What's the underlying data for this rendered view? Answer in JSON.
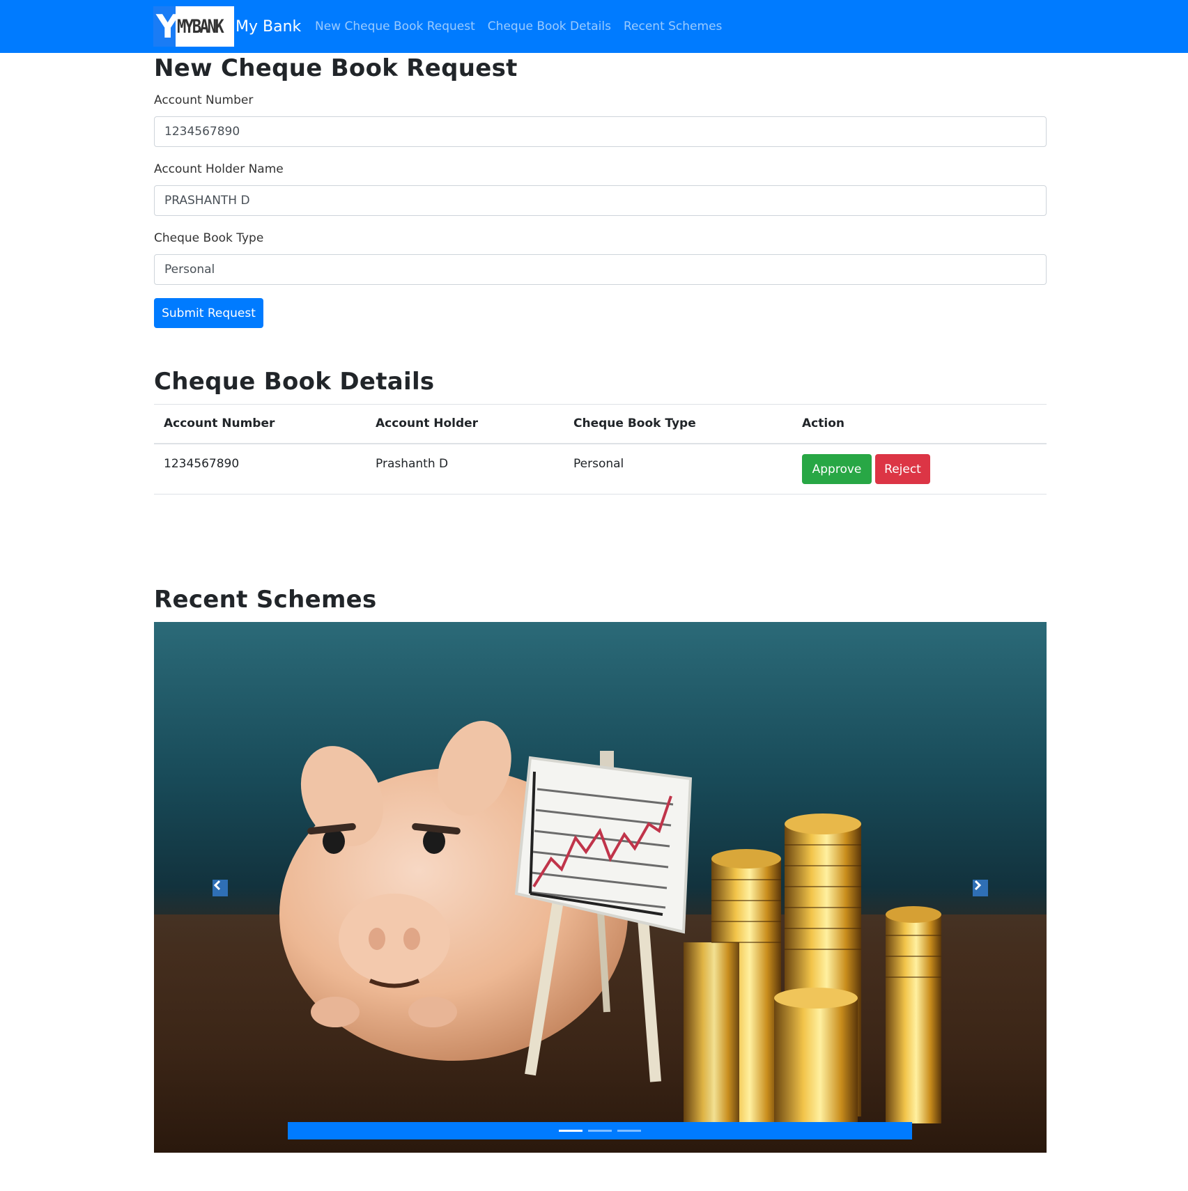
{
  "navbar": {
    "logo_text": "MYBANK",
    "logo_letter": "Y",
    "brand": "My Bank",
    "links": [
      {
        "label": "New Cheque Book Request"
      },
      {
        "label": "Cheque Book Details"
      },
      {
        "label": "Recent Schemes"
      }
    ]
  },
  "request_form": {
    "title": "New Cheque Book Request",
    "account_number_label": "Account Number",
    "account_number_value": "1234567890",
    "holder_name_label": "Account Holder Name",
    "holder_name_value": "PRASHANTH D",
    "book_type_label": "Cheque Book Type",
    "book_type_value": "Personal",
    "submit_label": "Submit Request"
  },
  "details": {
    "title": "Cheque Book Details",
    "columns": [
      "Account Number",
      "Account Holder",
      "Cheque Book Type",
      "Action"
    ],
    "rows": [
      {
        "account_number": "1234567890",
        "account_holder": "Prashanth D",
        "book_type": "Personal",
        "approve_label": "Approve",
        "reject_label": "Reject"
      }
    ]
  },
  "schemes": {
    "title": "Recent Schemes",
    "slide_count": 3,
    "active_slide": 1,
    "prev_icon": "chevron-left-icon",
    "next_icon": "chevron-right-icon"
  },
  "colors": {
    "primary": "#007bff",
    "success": "#28a745",
    "danger": "#dc3545"
  }
}
